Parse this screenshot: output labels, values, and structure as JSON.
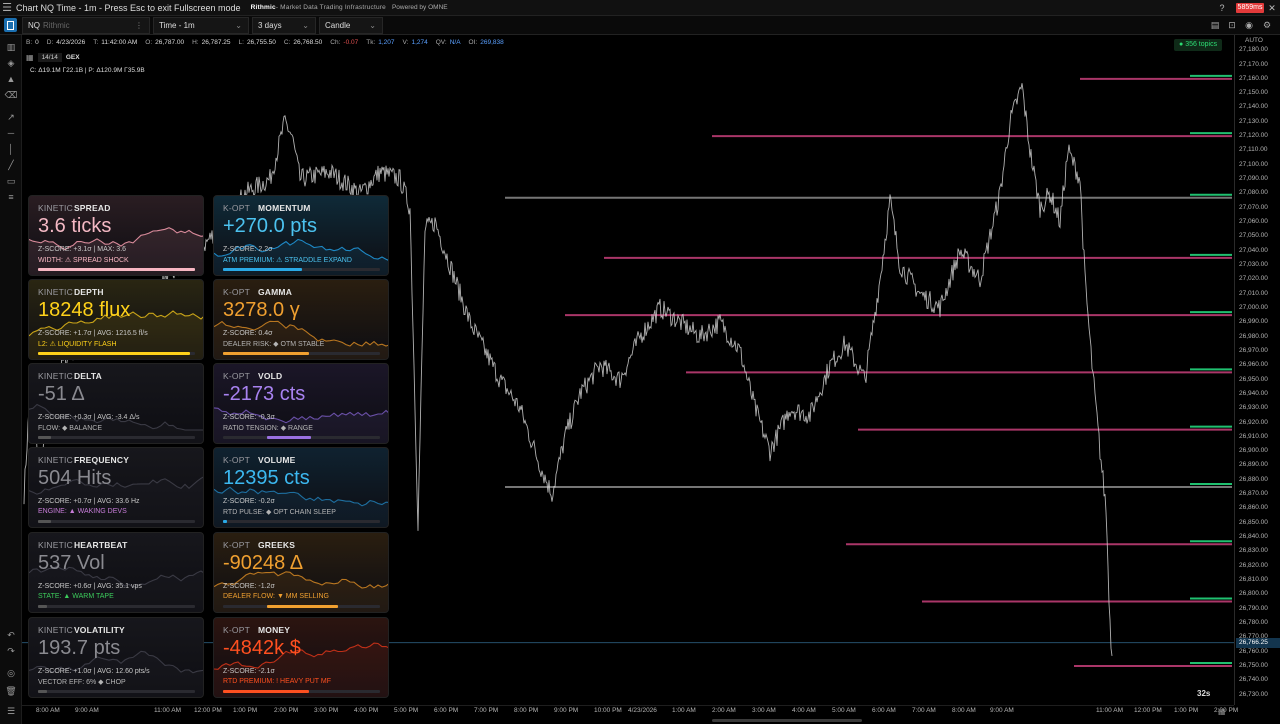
{
  "window": {
    "title": "Chart NQ Time - 1m - Press Esc to exit Fullscreen mode",
    "source_label": "Rithmic",
    "source_sub": "- Market Data Trading Infrastructure",
    "powered": "Powered by OMNE",
    "latency": "5859ms"
  },
  "toolbar": {
    "symbol": "NQ",
    "symbol_placeholder": "Rithmic",
    "interval": "Time - 1m",
    "range": "3 days",
    "style": "Candle"
  },
  "ohlc": {
    "b_label": "B:",
    "b": "0",
    "d_label": "D:",
    "d": "4/23/2026",
    "t_label": "T:",
    "t": "11:42:00 AM",
    "o_label": "O:",
    "o": "26,787.00",
    "h_label": "H:",
    "h": "26,787.25",
    "l_label": "L:",
    "l": "26,755.50",
    "c_label": "C:",
    "c": "26,768.50",
    "ch_label": "Ch:",
    "ch": "-0.07",
    "tk_label": "Tk:",
    "tk": "1,207",
    "v_label": "V:",
    "v": "1,274",
    "qv_label": "QV:",
    "qv": "N/A",
    "oi_label": "OI:",
    "oi": "269,838"
  },
  "study": {
    "count": "14/14",
    "name": "GEX"
  },
  "gex_summary": "C: Δ19.1M Γ22.1B  |  P: Δ120.9M Γ35.9B",
  "topics": "356 topics",
  "countdown": "32s",
  "price_axis": {
    "auto": "AUTO",
    "labels": [
      "27,180.00",
      "27,170.00",
      "27,160.00",
      "27,150.00",
      "27,140.00",
      "27,130.00",
      "27,120.00",
      "27,110.00",
      "27,100.00",
      "27,090.00",
      "27,080.00",
      "27,070.00",
      "27,060.00",
      "27,050.00",
      "27,040.00",
      "27,030.00",
      "27,020.00",
      "27,010.00",
      "27,000.00",
      "26,990.00",
      "26,980.00",
      "26,970.00",
      "26,960.00",
      "26,950.00",
      "26,940.00",
      "26,930.00",
      "26,920.00",
      "26,910.00",
      "26,900.00",
      "26,890.00",
      "26,880.00",
      "26,870.00",
      "26,860.00",
      "26,850.00",
      "26,840.00",
      "26,830.00",
      "26,820.00",
      "26,810.00",
      "26,800.00",
      "26,790.00",
      "26,780.00",
      "26,770.00",
      "26,760.00",
      "26,750.00",
      "26,740.00",
      "26,730.00"
    ],
    "current": "26,766.25"
  },
  "time_axis": [
    "8:00 AM",
    "9:00 AM",
    "11:00 AM",
    "12:00 PM",
    "1:00 PM",
    "2:00 PM",
    "3:00 PM",
    "4:00 PM",
    "5:00 PM",
    "6:00 PM",
    "7:00 PM",
    "8:00 PM",
    "9:00 PM",
    "10:00 PM",
    "4/23/2026",
    "1:00 AM",
    "2:00 AM",
    "3:00 AM",
    "4:00 AM",
    "5:00 AM",
    "6:00 AM",
    "7:00 AM",
    "8:00 AM",
    "9:00 AM",
    "11:00 AM",
    "12:00 PM",
    "1:00 PM",
    "2:00 PM"
  ],
  "gex_levels": [
    {
      "price": 27160,
      "kind": "magenta"
    },
    {
      "price": 27120,
      "kind": "magenta"
    },
    {
      "price": 27077,
      "kind": "grey"
    },
    {
      "price": 27035,
      "kind": "magenta"
    },
    {
      "price": 26995,
      "kind": "magenta"
    },
    {
      "price": 26955,
      "kind": "magenta"
    },
    {
      "price": 26915,
      "kind": "magenta"
    },
    {
      "price": 26875,
      "kind": "grey"
    },
    {
      "price": 26835,
      "kind": "magenta"
    },
    {
      "price": 26795,
      "kind": "magenta"
    },
    {
      "price": 26750,
      "kind": "magenta"
    }
  ],
  "colors": {
    "magenta": "#c8407a",
    "grey": "#8a8a8a",
    "green": "#20c070",
    "price_line": "#cfcfcf"
  },
  "cards": [
    {
      "prefix": "KINETIC",
      "name": "SPREAD",
      "value": "3.6 ticks",
      "value_color": "#f4b8c4",
      "line1": "Z-SCORE: +3.1σ  |  MAX: 3.6",
      "line2": "WIDTH: ⚠ SPREAD SHOCK",
      "line2_color": "#f7b6c2",
      "bar_color": "#f7b6c2",
      "bar_fill": 1.0,
      "bg": "#2a1d22",
      "spark": "#d88a9a"
    },
    {
      "prefix": "K-OPT",
      "name": "MOMENTUM",
      "value": "+270.0 pts",
      "value_color": "#4cc3f0",
      "line1": "Z-SCORE: 2.2σ",
      "line2": "ATM  PREMIUM: ⚠ STRADDLE EXPAND",
      "line2_color": "#4cc3f0",
      "bar_color": "#2aa9e6",
      "bar_fill": 0.5,
      "bg": "#0f2a38",
      "spark": "#1e88c4"
    },
    {
      "prefix": "KINETIC",
      "name": "DEPTH",
      "value": "18248 flux",
      "value_color": "#ffd21a",
      "line1": "Z-SCORE: +1.7σ  |  AVG: 1216.5 fl/s",
      "line2": "L2: ⚠ LIQUIDITY FLASH",
      "line2_color": "#ffd21a",
      "bar_color": "#ffd21a",
      "bar_fill": 0.97,
      "bg": "#2a2612",
      "spark": "#c9a418"
    },
    {
      "prefix": "K-OPT",
      "name": "GAMMA",
      "value": "3278.0 γ",
      "value_color": "#f0a030",
      "line1": "Z-SCORE: 0.4σ",
      "line2": "DEALER  RISK: ◆ OTM STABLE",
      "line2_color": "#b4b4b4",
      "bar_color": "#f0a030",
      "bar_fill": 0.55,
      "bg": "#2a1e10",
      "spark": "#b87620"
    },
    {
      "prefix": "KINETIC",
      "name": "DELTA",
      "value": "-51 Δ",
      "value_color": "#8a8a90",
      "line1": "Z-SCORE: +0.3σ  |  AVG: -3.4 Δ/s",
      "line2": "FLOW: ◆ BALANCE",
      "line2_color": "#b4b4b4",
      "bar_color": "#555",
      "bar_fill": 0.08,
      "bg": "#17171c",
      "spark": "#3a3a44"
    },
    {
      "prefix": "K-OPT",
      "name": "VOLD",
      "value": "-2173 cts",
      "value_color": "#a882f0",
      "line1": "Z-SCORE: -0.3σ",
      "line2": "RATIO  TENSION: ◆ RANGE",
      "line2_color": "#b4b4b4",
      "bar_color": "#9a70e0",
      "bar_fill": 0.28,
      "bg": "#1b1628",
      "spark": "#6a50a8"
    },
    {
      "prefix": "KINETIC",
      "name": "FREQUENCY",
      "value": "504 Hits",
      "value_color": "#8a8a90",
      "line1": "Z-SCORE: +0.7σ  |  AVG: 33.6 Hz",
      "line2": "ENGINE: ▲ WAKING DEVS",
      "line2_color": "#c77dd8",
      "bar_color": "#555",
      "bar_fill": 0.08,
      "bg": "#17171c",
      "spark": "#3a3a44"
    },
    {
      "prefix": "K-OPT",
      "name": "VOLUME",
      "value": "12395 cts",
      "value_color": "#3cb8f0",
      "line1": "Z-SCORE: -0.2σ",
      "line2": "RTD  PULSE: ◆ OPT CHAIN SLEEP",
      "line2_color": "#b4b4b4",
      "bar_color": "#2aa9e6",
      "bar_fill": 0.02,
      "bg": "#0f2230",
      "spark": "#1e6fa0"
    },
    {
      "prefix": "KINETIC",
      "name": "HEARTBEAT",
      "value": "537 Vol",
      "value_color": "#8a8a90",
      "line1": "Z-SCORE: +0.6σ  |  AVG: 35.1 vps",
      "line2": "STATE: ▲ WARM TAPE",
      "line2_color": "#3ccc5c",
      "bar_color": "#555",
      "bar_fill": 0.06,
      "bg": "#17171c",
      "spark": "#3a3a44"
    },
    {
      "prefix": "K-OPT",
      "name": "GREEKS",
      "value": "-90248 Δ",
      "value_color": "#f0a030",
      "line1": "Z-SCORE: -1.2σ",
      "line2": "DEALER  FLOW: ▼ MM SELLING",
      "line2_color": "#f0a030",
      "bar_color": "#f0a030",
      "bar_fill": 0.45,
      "bg": "#2a1e10",
      "spark": "#b87620"
    },
    {
      "prefix": "KINETIC",
      "name": "VOLATILITY",
      "value": "193.7 pts",
      "value_color": "#8a8a90",
      "line1": "Z-SCORE: +1.0σ  |  AVG: 12.60 pts/s",
      "line2": "VECTOR EFF: 6% ◆ CHOP",
      "line2_color": "#b4b4b4",
      "bar_color": "#555",
      "bar_fill": 0.06,
      "bg": "#17171c",
      "spark": "#3a3a44"
    },
    {
      "prefix": "K-OPT",
      "name": "MONEY",
      "value": "-4842k $",
      "value_color": "#ff5020",
      "line1": "Z-SCORE: -2.1σ",
      "line2": "RTD  PREMIUM: ! HEAVY PUT MF",
      "line2_color": "#ff5020",
      "bar_color": "#ff5020",
      "bar_fill": 0.55,
      "bg": "#2c1410",
      "spark": "#c03018"
    }
  ]
}
